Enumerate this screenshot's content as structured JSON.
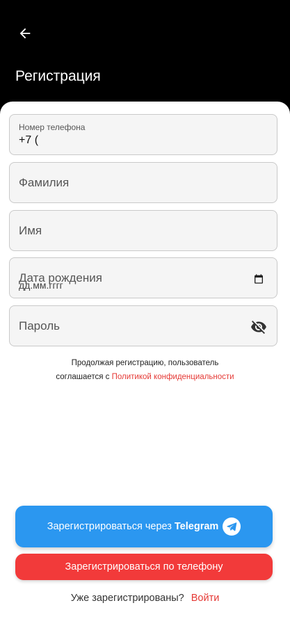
{
  "header": {
    "back_icon": "arrow-left-icon",
    "title": "Регистрация"
  },
  "form": {
    "phone": {
      "label": "Номер телефона",
      "value": "+7 ("
    },
    "surname": {
      "placeholder": "Фамилия"
    },
    "name": {
      "placeholder": "Имя"
    },
    "birthdate": {
      "placeholder": "Дата рождения",
      "mask": "дд.мм.гггг",
      "icon": "calendar-icon"
    },
    "password": {
      "placeholder": "Пароль",
      "icon": "eye-off-icon"
    }
  },
  "consent": {
    "line1": "Продолжая регистрацию, пользователь",
    "line2_prefix": "соглашается с ",
    "link": "Политикой конфиденциальности"
  },
  "buttons": {
    "telegram_prefix": "Зарегистрироваться через",
    "telegram_brand": "Telegram",
    "telegram_icon": "telegram-icon",
    "phone": "Зарегистрироваться по телефону"
  },
  "login": {
    "question": "Уже зарегистрированы?",
    "link": "Войти"
  },
  "colors": {
    "telegram_blue": "#2b97f0",
    "accent_red": "#f23a3a",
    "link_red": "#e53935"
  }
}
